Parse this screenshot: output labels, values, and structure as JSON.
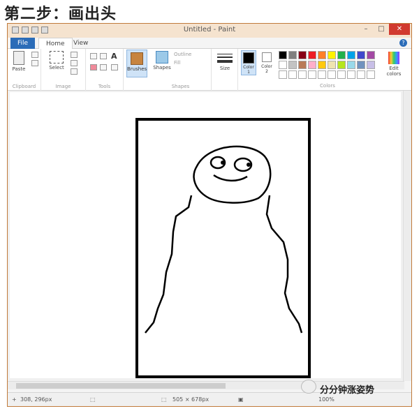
{
  "heading": "第二步：画出头",
  "window": {
    "title": "Untitled - Paint",
    "controls": {
      "minimize": "–",
      "maximize": "□",
      "close": "✕"
    }
  },
  "tabs": [
    {
      "label": "File"
    },
    {
      "label": "Home"
    },
    {
      "label": "View"
    }
  ],
  "help": "?",
  "ribbon": {
    "clipboard": {
      "paste": "Paste",
      "group": "Clipboard"
    },
    "image": {
      "select": "Select",
      "group": "Image"
    },
    "tools": {
      "group": "Tools",
      "text_tool": "A"
    },
    "brushes": {
      "label": "Brushes"
    },
    "shapes": {
      "label": "Shapes",
      "outline": "Outline",
      "fill": "Fill",
      "group": "Shapes"
    },
    "size": {
      "label": "Size"
    },
    "color1": {
      "label": "Color",
      "num": "1"
    },
    "color2": {
      "label": "Color",
      "num": "2"
    },
    "colors_group": "Colors",
    "edit_colors": "Edit colors",
    "palette": [
      "#000000",
      "#7f7f7f",
      "#880015",
      "#ed1c24",
      "#ff7f27",
      "#fff200",
      "#22b14c",
      "#00a2e8",
      "#3f48cc",
      "#a349a4",
      "#ffffff",
      "#c3c3c3",
      "#b97a57",
      "#ffaec9",
      "#ffc90e",
      "#efe4b0",
      "#b5e61d",
      "#99d9ea",
      "#7092be",
      "#c8bfe7",
      "#ffffff",
      "#ffffff",
      "#ffffff",
      "#ffffff",
      "#ffffff",
      "#ffffff",
      "#ffffff",
      "#ffffff",
      "#ffffff",
      "#ffffff"
    ]
  },
  "status": {
    "cursor": "308, 296px",
    "canvas_size": "505 × 678px",
    "zoom": "100%"
  },
  "watermark": "分分钟涨姿势"
}
